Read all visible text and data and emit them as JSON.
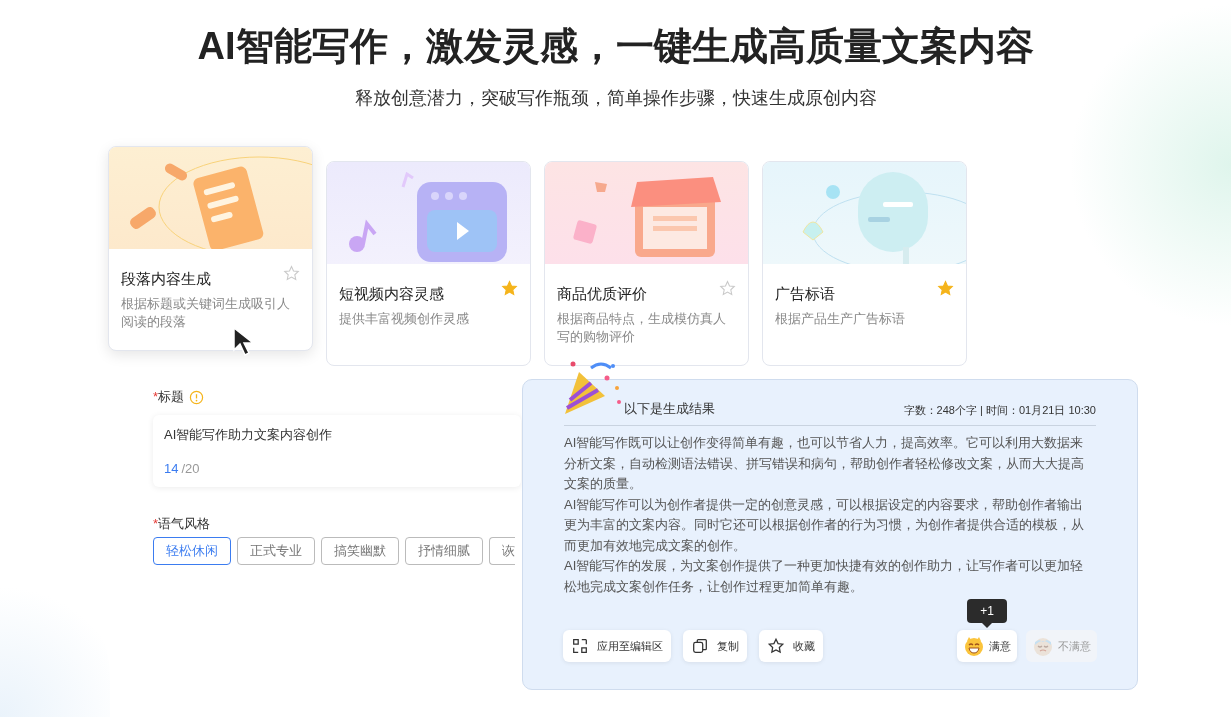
{
  "header": {
    "title": "AI智能写作，激发灵感，一键生成高质量文案内容",
    "subtitle": "释放创意潜力，突破写作瓶颈，简单操作步骤，快速生成原创内容"
  },
  "cards": [
    {
      "kind": "paragraph",
      "title": "段落内容生成",
      "description": "根据标题或关键词生成吸引人阅读的段落",
      "starred": false,
      "hovered": true
    },
    {
      "kind": "video",
      "title": "短视频内容灵感",
      "description": "提供丰富视频创作灵感",
      "starred": true,
      "hovered": false
    },
    {
      "kind": "shop",
      "title": "商品优质评价",
      "description": "根据商品特点，生成模仿真人写的购物评价",
      "starred": false,
      "hovered": false
    },
    {
      "kind": "slogan",
      "title": "广告标语",
      "description": "根据产品生产广告标语",
      "starred": true,
      "hovered": false
    }
  ],
  "form": {
    "title_label": "标题",
    "required_mark": "*",
    "title_value": "AI智能写作助力文案内容创作",
    "count": "14",
    "limit": "/20",
    "tone_label": "语气风格",
    "tones": [
      {
        "label": "轻松休闲",
        "selected": true
      },
      {
        "label": "正式专业",
        "selected": false
      },
      {
        "label": "搞笑幽默",
        "selected": false
      },
      {
        "label": "抒情细腻",
        "selected": false
      },
      {
        "label": "诙",
        "selected": false
      }
    ]
  },
  "result": {
    "heading": "以下是生成结果",
    "meta": "字数：248个字 | 时间：01月21日 10:30",
    "paragraphs": [
      "AI智能写作既可以让创作变得简单有趣，也可以节省人力，提高效率。它可以利用大数据来分析文案，自动检测语法错误、拼写错误和病句，帮助创作者轻松修改文案，从而大大提高文案的质量。",
      "AI智能写作可以为创作者提供一定的创意灵感，可以根据设定的内容要求，帮助创作者输出更为丰富的文案内容。同时它还可以根据创作者的行为习惯，为创作者提供合适的模板，从而更加有效地完成文案的创作。",
      "AI智能写作的发展，为文案创作提供了一种更加快捷有效的创作助力，让写作者可以更加轻松地完成文案创作任务，让创作过程更加简单有趣。"
    ],
    "actions": [
      {
        "kind": "apply",
        "label": "应用至编辑区"
      },
      {
        "kind": "copy",
        "label": "复制"
      },
      {
        "kind": "favorite",
        "label": "收藏"
      }
    ],
    "feedback": [
      {
        "kind": "like",
        "label": "满意",
        "selected": true
      },
      {
        "kind": "dislike",
        "label": "不满意",
        "selected": false
      }
    ],
    "tooltip": "+1"
  }
}
